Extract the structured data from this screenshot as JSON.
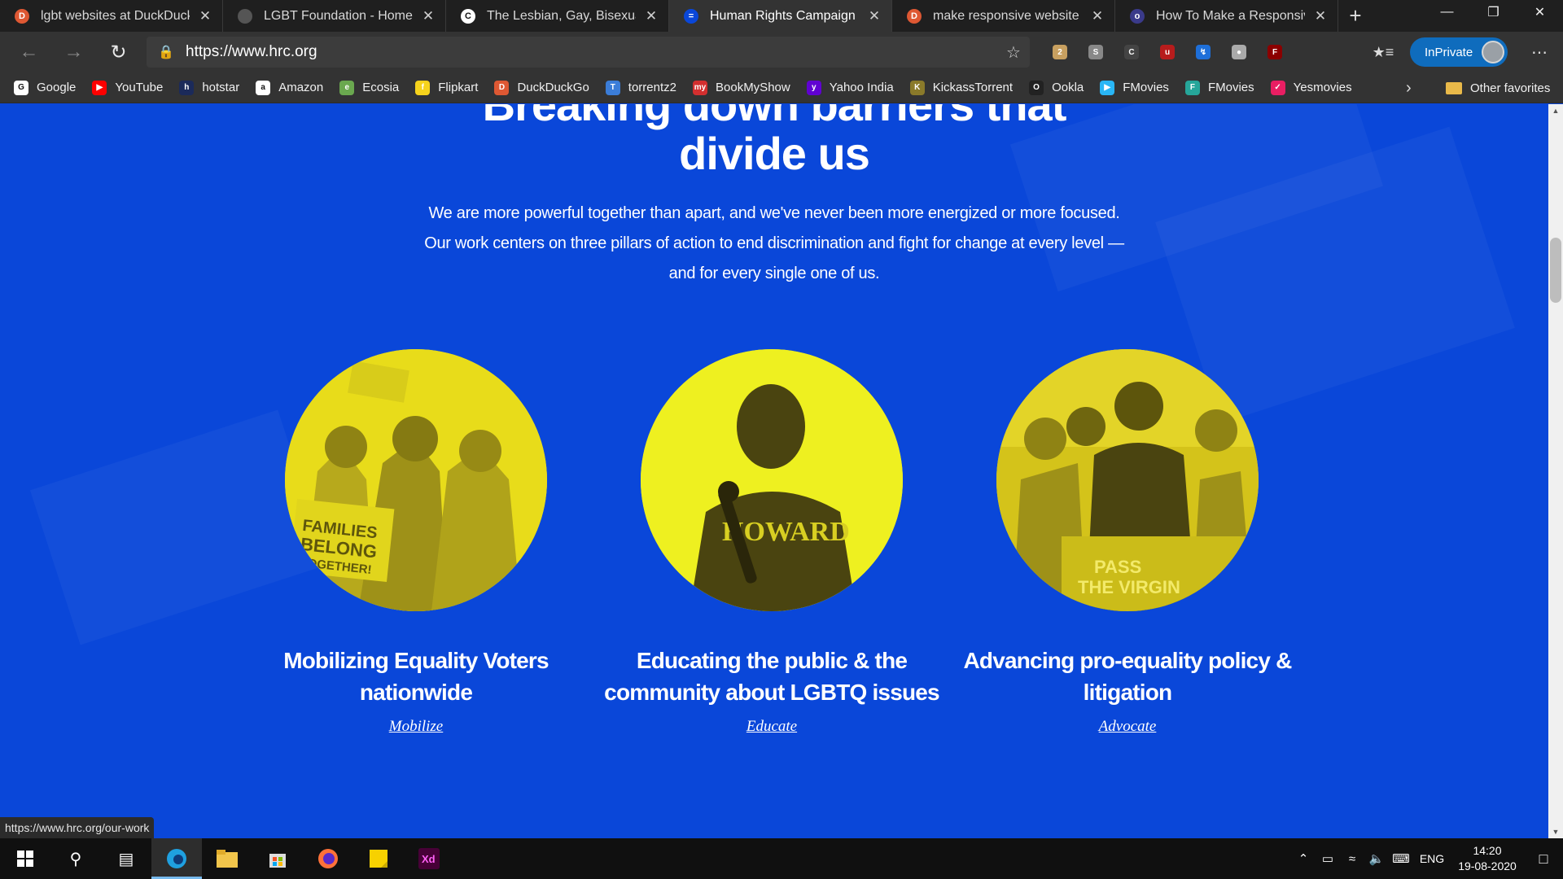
{
  "tabs": [
    {
      "title": "lgbt websites at DuckDuckGo",
      "favicon_color": "#de5833",
      "favicon_glyph": "D",
      "active": false
    },
    {
      "title": "LGBT Foundation - Home",
      "favicon_color": "#555555",
      "favicon_glyph": "",
      "active": false
    },
    {
      "title": "The Lesbian, Gay, Bisexual &",
      "favicon_color": "#ffffff",
      "favicon_glyph": "C",
      "active": false
    },
    {
      "title": "Human Rights Campaign - H",
      "favicon_color": "#0a47d9",
      "favicon_glyph": "=",
      "active": true
    },
    {
      "title": "make responsive website at",
      "favicon_color": "#de5833",
      "favicon_glyph": "D",
      "active": false
    },
    {
      "title": "How To Make a Responsive W",
      "favicon_color": "#3a3a8a",
      "favicon_glyph": "o",
      "active": false
    }
  ],
  "address_bar": {
    "url": "https://www.hrc.org"
  },
  "inprivate_label": "InPrivate",
  "extensions": [
    {
      "name": "ext-1-icon",
      "color": "#c8a060",
      "glyph": "2"
    },
    {
      "name": "ext-2-icon",
      "color": "#888888",
      "glyph": "S"
    },
    {
      "name": "ext-3-icon",
      "color": "#444444",
      "glyph": "C"
    },
    {
      "name": "ublock-icon",
      "color": "#b71c1c",
      "glyph": "u"
    },
    {
      "name": "ext-5-icon",
      "color": "#1e6fd9",
      "glyph": "↯"
    },
    {
      "name": "ext-6-icon",
      "color": "#aaaaaa",
      "glyph": "●"
    },
    {
      "name": "flash-icon",
      "color": "#8b0000",
      "glyph": "F"
    }
  ],
  "favorites": [
    {
      "label": "Google",
      "color": "#ffffff",
      "glyph": "G"
    },
    {
      "label": "YouTube",
      "color": "#ff0000",
      "glyph": "▶"
    },
    {
      "label": "hotstar",
      "color": "#1b2a5a",
      "glyph": "h"
    },
    {
      "label": "Amazon",
      "color": "#ffffff",
      "glyph": "a"
    },
    {
      "label": "Ecosia",
      "color": "#6aa84f",
      "glyph": "e"
    },
    {
      "label": "Flipkart",
      "color": "#f6d31c",
      "glyph": "f"
    },
    {
      "label": "DuckDuckGo",
      "color": "#de5833",
      "glyph": "D"
    },
    {
      "label": "torrentz2",
      "color": "#3b7dd8",
      "glyph": "T"
    },
    {
      "label": "BookMyShow",
      "color": "#d32f2f",
      "glyph": "my"
    },
    {
      "label": "Yahoo India",
      "color": "#6001d2",
      "glyph": "y"
    },
    {
      "label": "KickassTorrent",
      "color": "#8a7a2a",
      "glyph": "K"
    },
    {
      "label": "Ookla",
      "color": "#222222",
      "glyph": "O"
    },
    {
      "label": "FMovies",
      "color": "#29b6f6",
      "glyph": "▶"
    },
    {
      "label": "FMovies",
      "color": "#26a69a",
      "glyph": "F"
    },
    {
      "label": "Yesmovies",
      "color": "#e91e63",
      "glyph": "✓"
    }
  ],
  "other_favorites": "Other favorites",
  "page": {
    "heading_partial": "Breaking down barriers that",
    "heading": "divide us",
    "lead": "We are more powerful together than apart, and we've never been more energized or more focused. Our work centers on three pillars of action to end discrimination and fight for change at every level — and for every single one of us.",
    "pillars": [
      {
        "title": "Mobilizing Equality Voters nationwide",
        "link": "Mobilize",
        "image_text": "FAMILIES BELONG TOGETHER!"
      },
      {
        "title": "Educating the public & the community about LGBTQ issues",
        "link": "Educate",
        "image_text": "HOWARD"
      },
      {
        "title": "Advancing pro-equality policy & litigation",
        "link": "Advocate",
        "image_text": "PASS THE VIRGINIA VALUES"
      }
    ],
    "accent_yellow": "#e8dc1a",
    "background_blue": "#0a47d9"
  },
  "status_url": "https://www.hrc.org/our-work",
  "taskbar": {
    "apps": [
      "start-icon",
      "search-icon",
      "task-view-icon",
      "edge-icon",
      "file-explorer-icon",
      "store-icon",
      "firefox-icon",
      "sticky-notes-icon",
      "adobe-xd-icon"
    ],
    "lang": "ENG",
    "time": "14:20",
    "date": "19-08-2020"
  }
}
